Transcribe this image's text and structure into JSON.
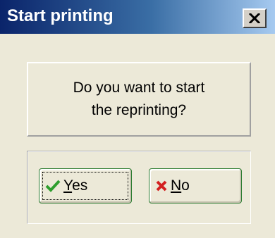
{
  "window": {
    "title": "Start printing",
    "close_label": "×"
  },
  "message": {
    "line1": "Do you want to start",
    "line2": "the reprinting?"
  },
  "buttons": {
    "yes": {
      "mnemonic": "Y",
      "rest": "es",
      "icon": "checkmark-icon"
    },
    "no": {
      "mnemonic": "N",
      "rest": "o",
      "icon": "red-x-icon"
    }
  },
  "colors": {
    "title_gradient_start": "#0a246a",
    "title_gradient_end": "#a6caf0",
    "check_green": "#2e9e2e",
    "x_red": "#d32020",
    "button_border": "#2e7d32"
  }
}
